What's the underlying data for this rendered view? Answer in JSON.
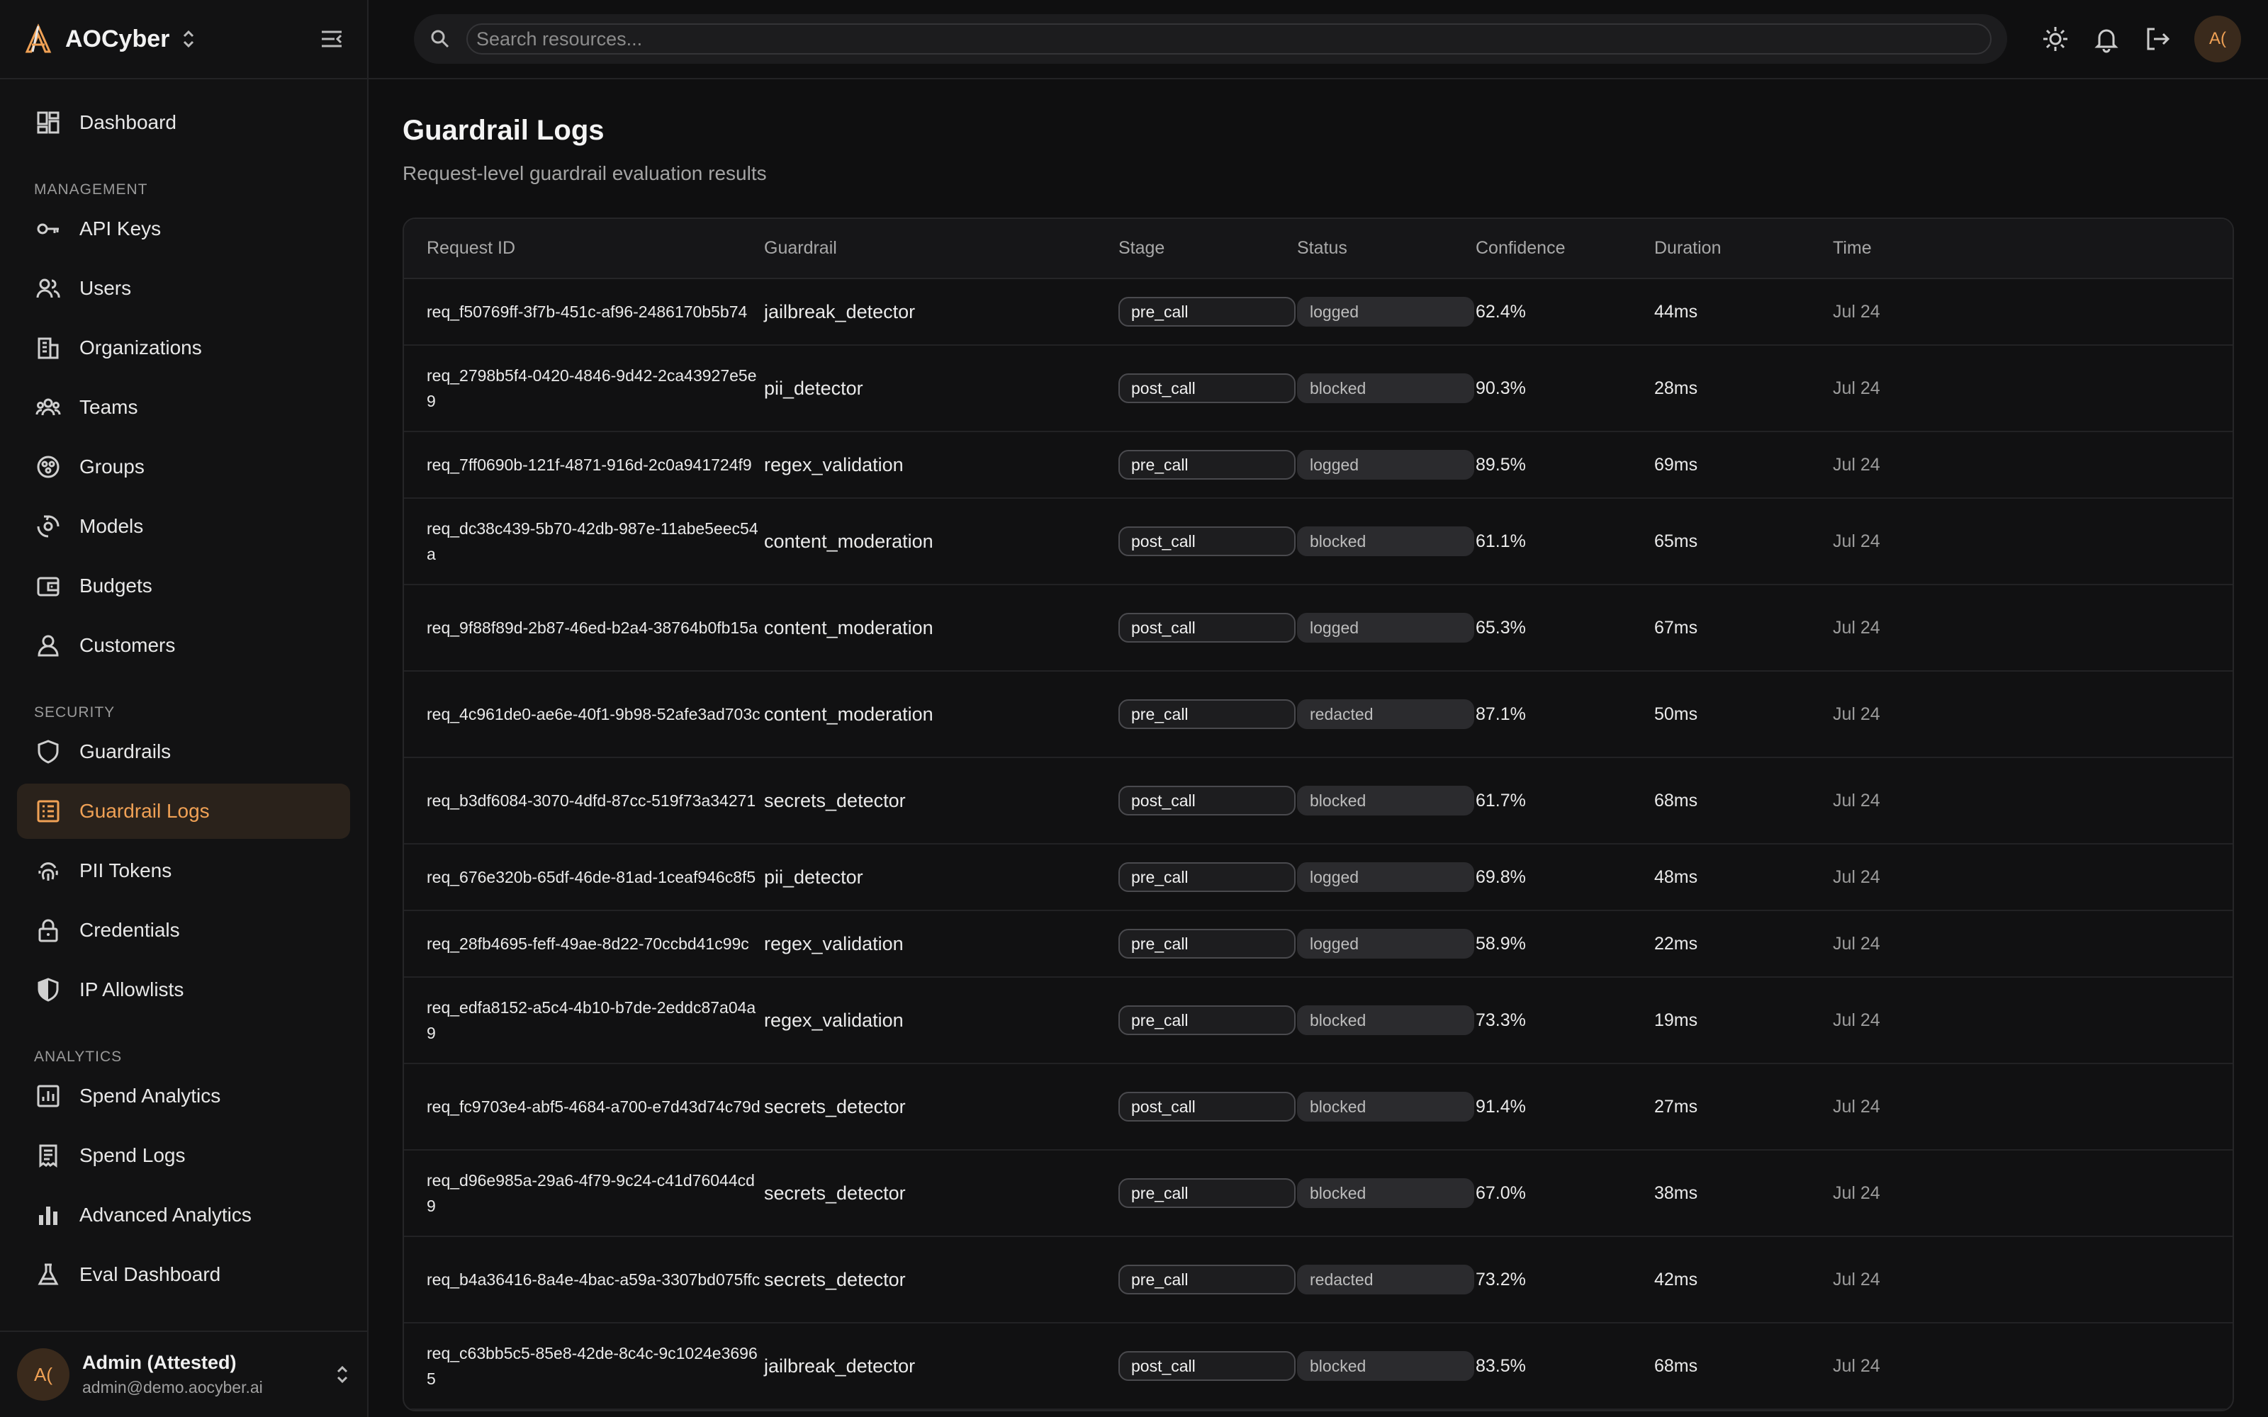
{
  "brand": {
    "name": "AOCyber"
  },
  "sidebar": {
    "top_items": [
      {
        "label": "Dashboard",
        "icon": "dashboard-icon"
      }
    ],
    "sections": [
      {
        "title": "MANAGEMENT",
        "items": [
          {
            "label": "API Keys",
            "icon": "key-icon"
          },
          {
            "label": "Users",
            "icon": "users-icon"
          },
          {
            "label": "Organizations",
            "icon": "building-icon"
          },
          {
            "label": "Teams",
            "icon": "team-icon"
          },
          {
            "label": "Groups",
            "icon": "groups-icon"
          },
          {
            "label": "Models",
            "icon": "models-icon"
          },
          {
            "label": "Budgets",
            "icon": "wallet-icon"
          },
          {
            "label": "Customers",
            "icon": "user-icon"
          }
        ]
      },
      {
        "title": "SECURITY",
        "items": [
          {
            "label": "Guardrails",
            "icon": "shield-icon"
          },
          {
            "label": "Guardrail Logs",
            "icon": "list-icon",
            "active": true
          },
          {
            "label": "PII Tokens",
            "icon": "fingerprint-icon"
          },
          {
            "label": "Credentials",
            "icon": "lock-icon"
          },
          {
            "label": "IP Allowlists",
            "icon": "shield-half-icon"
          }
        ]
      },
      {
        "title": "ANALYTICS",
        "items": [
          {
            "label": "Spend Analytics",
            "icon": "chart-box-icon"
          },
          {
            "label": "Spend Logs",
            "icon": "receipt-icon"
          },
          {
            "label": "Advanced Analytics",
            "icon": "bar-chart-icon"
          },
          {
            "label": "Eval Dashboard",
            "icon": "flask-icon"
          }
        ]
      }
    ]
  },
  "user": {
    "initials": "A(",
    "name": "Admin (Attested)",
    "email": "admin@demo.aocyber.ai"
  },
  "search": {
    "placeholder": "Search resources..."
  },
  "topbar": {
    "avatar_initials": "A("
  },
  "page": {
    "title": "Guardrail Logs",
    "subtitle": "Request-level guardrail evaluation results"
  },
  "table": {
    "columns": [
      "Request ID",
      "Guardrail",
      "Stage",
      "Status",
      "Confidence",
      "Duration",
      "Time"
    ],
    "rows": [
      {
        "id": "req_f50769ff-3f7b-451c-af96-2486170b5b74",
        "guardrail": "jailbreak_detector",
        "stage": "pre_call",
        "status": "logged",
        "confidence": "62.4%",
        "duration": "44ms",
        "time": "Jul 24",
        "tall": false
      },
      {
        "id": "req_2798b5f4-0420-4846-9d42-2ca43927e5e9",
        "guardrail": "pii_detector",
        "stage": "post_call",
        "status": "blocked",
        "confidence": "90.3%",
        "duration": "28ms",
        "time": "Jul 24",
        "tall": true
      },
      {
        "id": "req_7ff0690b-121f-4871-916d-2c0a941724f9",
        "guardrail": "regex_validation",
        "stage": "pre_call",
        "status": "logged",
        "confidence": "89.5%",
        "duration": "69ms",
        "time": "Jul 24",
        "tall": false
      },
      {
        "id": "req_dc38c439-5b70-42db-987e-11abe5eec54a",
        "guardrail": "content_moderation",
        "stage": "post_call",
        "status": "blocked",
        "confidence": "61.1%",
        "duration": "65ms",
        "time": "Jul 24",
        "tall": true
      },
      {
        "id": "req_9f88f89d-2b87-46ed-b2a4-38764b0fb15a",
        "guardrail": "content_moderation",
        "stage": "post_call",
        "status": "logged",
        "confidence": "65.3%",
        "duration": "67ms",
        "time": "Jul 24",
        "tall": true
      },
      {
        "id": "req_4c961de0-ae6e-40f1-9b98-52afe3ad703c",
        "guardrail": "content_moderation",
        "stage": "pre_call",
        "status": "redacted",
        "confidence": "87.1%",
        "duration": "50ms",
        "time": "Jul 24",
        "tall": true
      },
      {
        "id": "req_b3df6084-3070-4dfd-87cc-519f73a34271",
        "guardrail": "secrets_detector",
        "stage": "post_call",
        "status": "blocked",
        "confidence": "61.7%",
        "duration": "68ms",
        "time": "Jul 24",
        "tall": true
      },
      {
        "id": "req_676e320b-65df-46de-81ad-1ceaf946c8f5",
        "guardrail": "pii_detector",
        "stage": "pre_call",
        "status": "logged",
        "confidence": "69.8%",
        "duration": "48ms",
        "time": "Jul 24",
        "tall": false
      },
      {
        "id": "req_28fb4695-feff-49ae-8d22-70ccbd41c99c",
        "guardrail": "regex_validation",
        "stage": "pre_call",
        "status": "logged",
        "confidence": "58.9%",
        "duration": "22ms",
        "time": "Jul 24",
        "tall": false
      },
      {
        "id": "req_edfa8152-a5c4-4b10-b7de-2eddc87a04a9",
        "guardrail": "regex_validation",
        "stage": "pre_call",
        "status": "blocked",
        "confidence": "73.3%",
        "duration": "19ms",
        "time": "Jul 24",
        "tall": true
      },
      {
        "id": "req_fc9703e4-abf5-4684-a700-e7d43d74c79d",
        "guardrail": "secrets_detector",
        "stage": "post_call",
        "status": "blocked",
        "confidence": "91.4%",
        "duration": "27ms",
        "time": "Jul 24",
        "tall": true
      },
      {
        "id": "req_d96e985a-29a6-4f79-9c24-c41d76044cd9",
        "guardrail": "secrets_detector",
        "stage": "pre_call",
        "status": "blocked",
        "confidence": "67.0%",
        "duration": "38ms",
        "time": "Jul 24",
        "tall": true
      },
      {
        "id": "req_b4a36416-8a4e-4bac-a59a-3307bd075ffc",
        "guardrail": "secrets_detector",
        "stage": "pre_call",
        "status": "redacted",
        "confidence": "73.2%",
        "duration": "42ms",
        "time": "Jul 24",
        "tall": true
      },
      {
        "id": "req_c63bb5c5-85e8-42de-8c4c-9c1024e36965",
        "guardrail": "jailbreak_detector",
        "stage": "post_call",
        "status": "blocked",
        "confidence": "83.5%",
        "duration": "68ms",
        "time": "Jul 24",
        "tall": true
      }
    ]
  },
  "colors": {
    "accent": "#f0a155",
    "background": "#0f0f10",
    "sidebar": "#121213"
  }
}
